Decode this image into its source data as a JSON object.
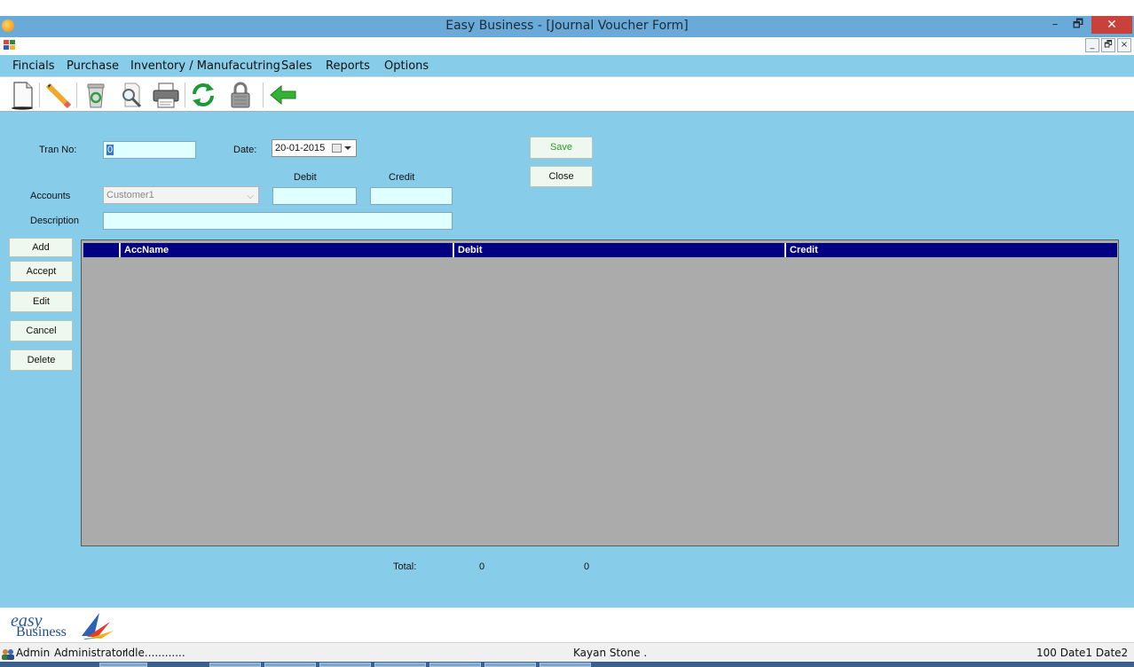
{
  "window": {
    "title": "Easy Business - [Journal Voucher Form]",
    "minimize": "–",
    "maximize": "🗗",
    "close": "✕"
  },
  "mdi": {
    "minimize": "_",
    "restore": "🗗",
    "close": "×"
  },
  "menu": [
    "Fincials",
    "Purchase",
    "Inventory / Manufacutring",
    "Sales",
    "Reports",
    "Options"
  ],
  "toolbar": {
    "icons": [
      "new-document-icon",
      "edit-pencil-icon",
      "recycle-bin-icon",
      "search-magnifier-icon",
      "printer-icon",
      "refresh-icon",
      "lock-icon",
      "back-arrow-icon"
    ]
  },
  "form": {
    "tran_no_label": "Tran No:",
    "tran_no_value": "0",
    "date_label": "Date:",
    "date_value": "20-01-2015",
    "debit_label": "Debit",
    "credit_label": "Credit",
    "accounts_label": "Accounts",
    "accounts_value": "Customer1",
    "description_label": "Description",
    "save_label": "Save",
    "close_label": "Close",
    "add_label": "Add",
    "accept_label": "Accept",
    "edit_label": "Edit",
    "cancel_label": "Cancel",
    "delete_label": "Delete",
    "total_label": "Total:",
    "total_debit": "0",
    "total_credit": "0"
  },
  "grid": {
    "columns": [
      "AccName",
      "Debit",
      "Credit"
    ]
  },
  "brand": {
    "line1": "easy",
    "line2": "Business"
  },
  "status": {
    "user": "Admin",
    "role": "Administrator",
    "state": "Idle............",
    "company": "Kayan Stone .",
    "right": "100  Date1  Date2"
  },
  "colors": {
    "form_bg": "#87cde9",
    "grid_header": "#000080",
    "input_bg": "#e0ffff",
    "save_text": "#2a9a2a"
  }
}
